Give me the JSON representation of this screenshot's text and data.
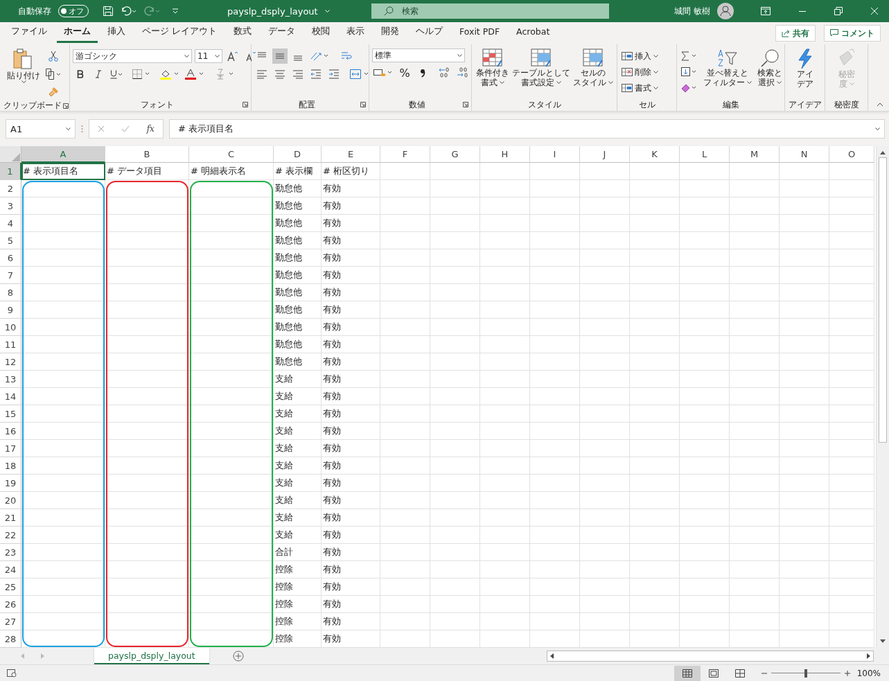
{
  "title_bar": {
    "autosave_label": "自動保存",
    "autosave": {
      "on": false,
      "label": "オフ"
    },
    "filename": "payslp_dsply_layout",
    "search_placeholder": "検索",
    "user": "城間 敏樹"
  },
  "tabs": [
    {
      "label": "ファイル",
      "selected": false
    },
    {
      "label": "ホーム",
      "selected": true
    },
    {
      "label": "挿入",
      "selected": false
    },
    {
      "label": "ページ レイアウト",
      "selected": false
    },
    {
      "label": "数式",
      "selected": false
    },
    {
      "label": "データ",
      "selected": false
    },
    {
      "label": "校閲",
      "selected": false
    },
    {
      "label": "表示",
      "selected": false
    },
    {
      "label": "開発",
      "selected": false
    },
    {
      "label": "ヘルプ",
      "selected": false
    },
    {
      "label": "Foxit PDF",
      "selected": false
    },
    {
      "label": "Acrobat",
      "selected": false
    }
  ],
  "share_button": "共有",
  "comment_button": "コメント",
  "ribbon": {
    "clipboard": {
      "label": "クリップボード",
      "paste": "貼り付け"
    },
    "font": {
      "label": "フォント",
      "font_name": "游ゴシック",
      "font_size": "11"
    },
    "alignment": {
      "label": "配置"
    },
    "number": {
      "label": "数値",
      "format": "標準",
      "percent": "%"
    },
    "styles": {
      "label": "スタイル",
      "buttons": [
        [
          "条件付き",
          "書式"
        ],
        [
          "テーブルとして",
          "書式設定"
        ],
        [
          "セルの",
          "スタイル"
        ]
      ]
    },
    "cells": {
      "label": "セル",
      "buttons": [
        "挿入",
        "削除",
        "書式"
      ]
    },
    "editing": {
      "label": "編集",
      "buttons": [
        [
          "並べ替えと",
          "フィルター"
        ],
        [
          "検索と",
          "選択"
        ]
      ]
    },
    "ideas": {
      "label": "アイデア",
      "button": [
        "アイ",
        "デア"
      ]
    },
    "sensitivity": {
      "label": "秘密度",
      "button": [
        "秘密",
        "度"
      ],
      "disabled": true
    }
  },
  "formula_bar": {
    "name_box": "A1",
    "fx": "fx",
    "formula": "# 表示項目名"
  },
  "columns": [
    {
      "label": "A",
      "selected": true,
      "color": "#1ba1e2"
    },
    {
      "label": "B",
      "selected": false,
      "color": "#e8262b"
    },
    {
      "label": "C",
      "selected": false,
      "color": "#22b04b"
    },
    {
      "label": "D",
      "selected": false
    },
    {
      "label": "E",
      "selected": false
    },
    {
      "label": "F",
      "selected": false
    },
    {
      "label": "G",
      "selected": false
    },
    {
      "label": "H",
      "selected": false
    },
    {
      "label": "I",
      "selected": false
    },
    {
      "label": "J",
      "selected": false
    },
    {
      "label": "K",
      "selected": false
    },
    {
      "label": "L",
      "selected": false
    },
    {
      "label": "M",
      "selected": false
    },
    {
      "label": "N",
      "selected": false
    },
    {
      "label": "O",
      "selected": false
    }
  ],
  "rows": [
    {
      "number": "1",
      "selected": true,
      "cells": {
        "A": "# 表示項目名",
        "B": "# データ項目",
        "C": "# 明細表示名",
        "D": "# 表示欄",
        "E": "# 桁区切り"
      }
    },
    {
      "number": "2",
      "selected": false,
      "cells": {
        "D": "勤怠他",
        "E": "有効"
      }
    },
    {
      "number": "3",
      "selected": false,
      "cells": {
        "D": "勤怠他",
        "E": "有効"
      }
    },
    {
      "number": "4",
      "selected": false,
      "cells": {
        "D": "勤怠他",
        "E": "有効"
      }
    },
    {
      "number": "5",
      "selected": false,
      "cells": {
        "D": "勤怠他",
        "E": "有効"
      }
    },
    {
      "number": "6",
      "selected": false,
      "cells": {
        "D": "勤怠他",
        "E": "有効"
      }
    },
    {
      "number": "7",
      "selected": false,
      "cells": {
        "D": "勤怠他",
        "E": "有効"
      }
    },
    {
      "number": "8",
      "selected": false,
      "cells": {
        "D": "勤怠他",
        "E": "有効"
      }
    },
    {
      "number": "9",
      "selected": false,
      "cells": {
        "D": "勤怠他",
        "E": "有効"
      }
    },
    {
      "number": "10",
      "selected": false,
      "cells": {
        "D": "勤怠他",
        "E": "有効"
      }
    },
    {
      "number": "11",
      "selected": false,
      "cells": {
        "D": "勤怠他",
        "E": "有効"
      }
    },
    {
      "number": "12",
      "selected": false,
      "cells": {
        "D": "勤怠他",
        "E": "有効"
      }
    },
    {
      "number": "13",
      "selected": false,
      "cells": {
        "D": "支給",
        "E": "有効"
      }
    },
    {
      "number": "14",
      "selected": false,
      "cells": {
        "D": "支給",
        "E": "有効"
      }
    },
    {
      "number": "15",
      "selected": false,
      "cells": {
        "D": "支給",
        "E": "有効"
      }
    },
    {
      "number": "16",
      "selected": false,
      "cells": {
        "D": "支給",
        "E": "有効"
      }
    },
    {
      "number": "17",
      "selected": false,
      "cells": {
        "D": "支給",
        "E": "有効"
      }
    },
    {
      "number": "18",
      "selected": false,
      "cells": {
        "D": "支給",
        "E": "有効"
      }
    },
    {
      "number": "19",
      "selected": false,
      "cells": {
        "D": "支給",
        "E": "有効"
      }
    },
    {
      "number": "20",
      "selected": false,
      "cells": {
        "D": "支給",
        "E": "有効"
      }
    },
    {
      "number": "21",
      "selected": false,
      "cells": {
        "D": "支給",
        "E": "有効"
      }
    },
    {
      "number": "22",
      "selected": false,
      "cells": {
        "D": "支給",
        "E": "有効"
      }
    },
    {
      "number": "23",
      "selected": false,
      "cells": {
        "D": "合計",
        "E": "有効"
      }
    },
    {
      "number": "24",
      "selected": false,
      "cells": {
        "D": "控除",
        "E": "有効"
      }
    },
    {
      "number": "25",
      "selected": false,
      "cells": {
        "D": "控除",
        "E": "有効"
      }
    },
    {
      "number": "26",
      "selected": false,
      "cells": {
        "D": "控除",
        "E": "有効"
      }
    },
    {
      "number": "27",
      "selected": false,
      "cells": {
        "D": "控除",
        "E": "有効"
      }
    },
    {
      "number": "28",
      "selected": false,
      "cells": {
        "D": "控除",
        "E": "有効"
      }
    }
  ],
  "sheet_tabs": [
    {
      "label": "payslp_dsply_layout",
      "selected": true
    }
  ],
  "status_bar": {
    "zoom": "100%",
    "zoom_slider": {
      "level": 0.5
    }
  }
}
